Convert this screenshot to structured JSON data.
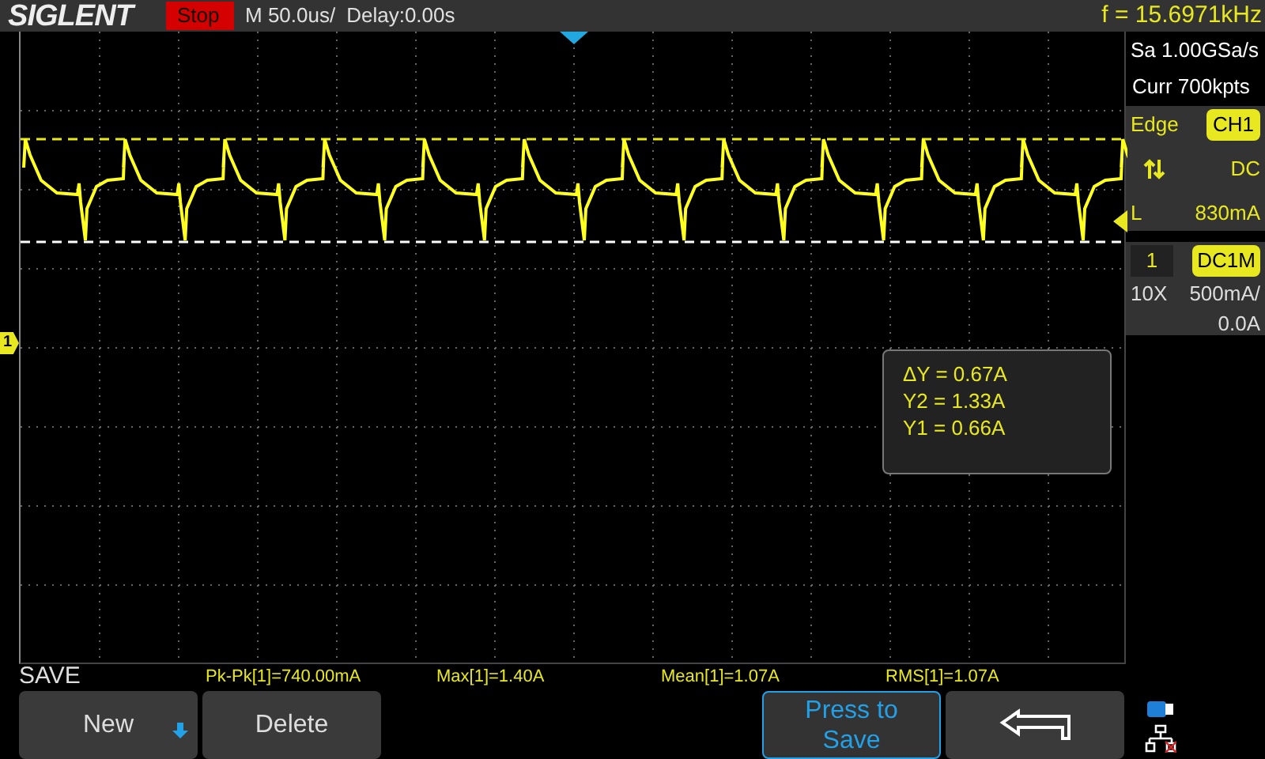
{
  "top_bar": {
    "brand": "SIGLENT",
    "run_state": "Stop",
    "timebase": "M 50.0us/",
    "delay": "Delay:0.00s",
    "frequency": "f = 15.6971kHz"
  },
  "acquisition": {
    "sample_rate": "Sa 1.00GSa/s",
    "memory_depth": "Curr 700kpts"
  },
  "trigger": {
    "type": "Edge",
    "source": "CH1",
    "coupling": "DC",
    "level_label": "L",
    "level": "830mA"
  },
  "channel": {
    "number": "1",
    "coupling": "DC1M",
    "probe": "10X",
    "scale": "500mA/",
    "offset": "0.0A"
  },
  "channel_marker": "1",
  "cursor_readout": [
    "ΔY = 0.67A",
    "Y2 = 1.33A",
    "Y1 = 0.66A"
  ],
  "menu_title": "SAVE",
  "measurements": [
    "Pk-Pk[1]=740.00mA",
    "Max[1]=1.40A",
    "Mean[1]=1.07A",
    "RMS[1]=1.07A"
  ],
  "softkeys": [
    {
      "kind": "dropdown",
      "label": "New"
    },
    {
      "kind": "plain",
      "label": "Delete"
    },
    {
      "kind": "empty"
    },
    {
      "kind": "highlight",
      "label": "Press to Save"
    },
    {
      "kind": "back"
    }
  ]
}
